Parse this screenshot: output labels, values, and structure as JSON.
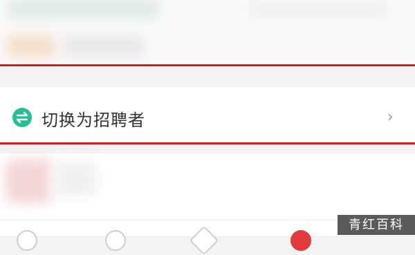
{
  "switch_row": {
    "icon": "swap-arrows-icon",
    "label": "切换为招聘者",
    "chevron": "›"
  },
  "watermark": {
    "text": "青红百科"
  },
  "colors": {
    "highlight_red": "#d21d1d",
    "icon_green": "#25c08e"
  }
}
